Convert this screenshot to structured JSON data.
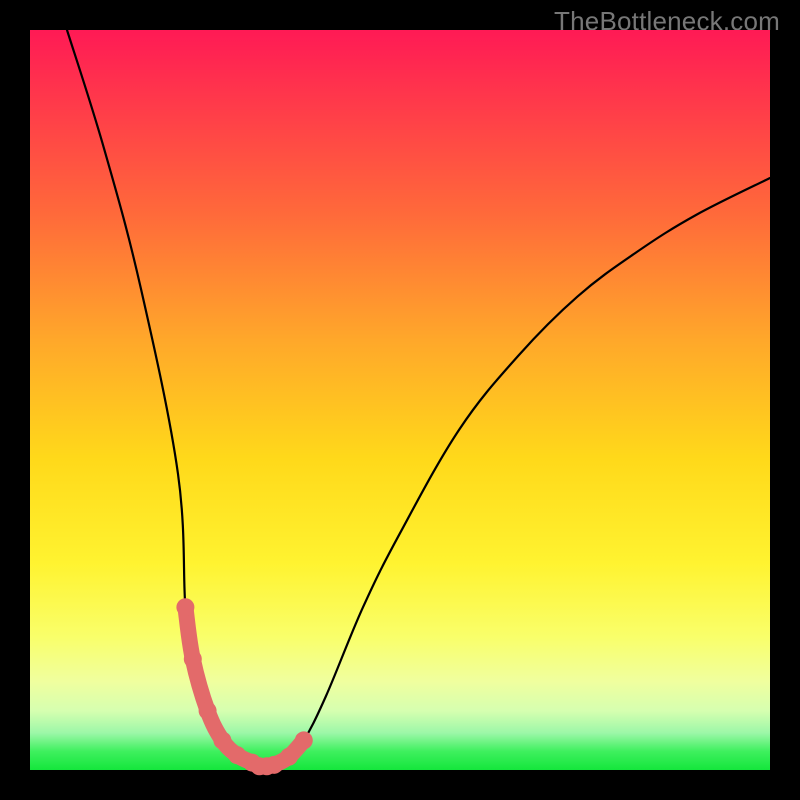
{
  "meta": {
    "watermark": "TheBottleneck.com"
  },
  "colors": {
    "curve_stroke": "#000000",
    "marker_fill": "#e36a6a",
    "gradient_top": "#ff1a55",
    "gradient_bottom": "#14e63c",
    "frame_bg": "#000000"
  },
  "chart_data": {
    "type": "line",
    "title": "",
    "xlabel": "",
    "ylabel": "",
    "xlim": [
      0,
      100
    ],
    "ylim": [
      0,
      100
    ],
    "grid": false,
    "legend_position": "none",
    "annotations": [
      "TheBottleneck.com"
    ],
    "series": [
      {
        "name": "bottleneck_curve",
        "x": [
          5,
          10,
          15,
          20,
          21,
          22,
          24,
          26,
          28,
          30,
          31,
          32,
          33,
          35,
          37,
          40,
          45,
          50,
          58,
          66,
          74,
          82,
          90,
          100
        ],
        "y": [
          100,
          84,
          65,
          40,
          22,
          15,
          8,
          4,
          2,
          1,
          0.5,
          0.5,
          0.7,
          1.8,
          4,
          10,
          22,
          32,
          46,
          56,
          64,
          70,
          75,
          80
        ]
      },
      {
        "name": "fit_region",
        "x": [
          21,
          22,
          24,
          26,
          28,
          30,
          31,
          32,
          33,
          35,
          37
        ],
        "y": [
          22,
          15,
          8,
          4,
          2,
          1,
          0.5,
          0.5,
          0.7,
          1.8,
          4
        ]
      }
    ]
  }
}
